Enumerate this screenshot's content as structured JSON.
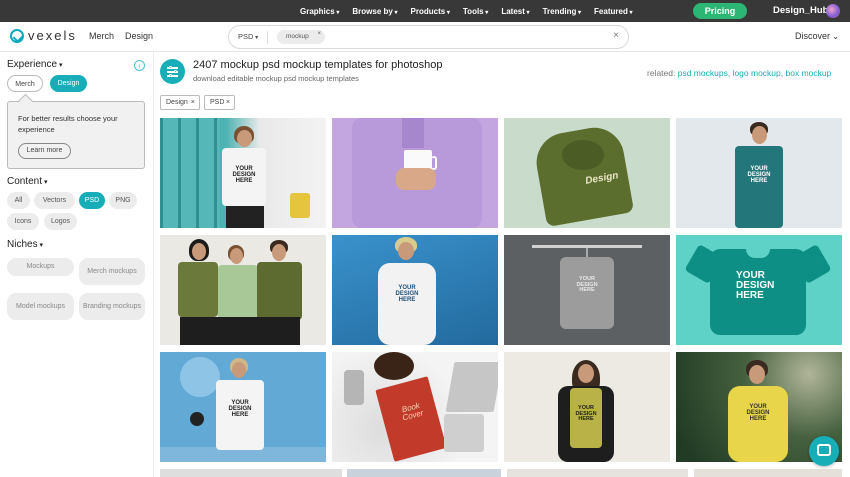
{
  "topnav": {
    "items": [
      "Graphics",
      "Browse by",
      "Products",
      "Tools",
      "Latest",
      "Trending",
      "Featured"
    ],
    "pricing": "Pricing",
    "user": "Design_Hub"
  },
  "header": {
    "logo_text": "vexels",
    "links": [
      "Merch",
      "Design"
    ],
    "search": {
      "type": "PSD",
      "chip": "mockup",
      "clear": "×"
    },
    "discover": "Discover"
  },
  "sidebar": {
    "experience": {
      "title": "Experience",
      "options": [
        "Merch",
        "Design"
      ],
      "active": "Design"
    },
    "tooltip": {
      "text": "For better results choose your experience",
      "button": "Learn more"
    },
    "content": {
      "title": "Content",
      "options": [
        "All",
        "Vectors",
        "PSD",
        "PNG",
        "Icons",
        "Logos"
      ],
      "active": "PSD"
    },
    "niches": {
      "title": "Niches",
      "options": [
        "Mockups",
        "Merch mockups",
        "Model mockups",
        "Branding mockups"
      ]
    }
  },
  "main": {
    "title": "2407 mockup psd mockup templates for photoshop",
    "subtitle": "download editable mockup psd mockup templates",
    "related_label": "related:",
    "related": [
      "psd mockups",
      "logo mockup",
      "box mockup"
    ],
    "filters": [
      "Design",
      "PSD"
    ],
    "filter_remove": "×",
    "thumb_texts": {
      "your_design_here": "YOUR DESIGN HERE",
      "design_here_script": "Design",
      "book_cover": "Book Cover"
    }
  },
  "colors": {
    "accent": "#17aeb8",
    "pricing": "#2bb673",
    "topbar": "#383838"
  }
}
